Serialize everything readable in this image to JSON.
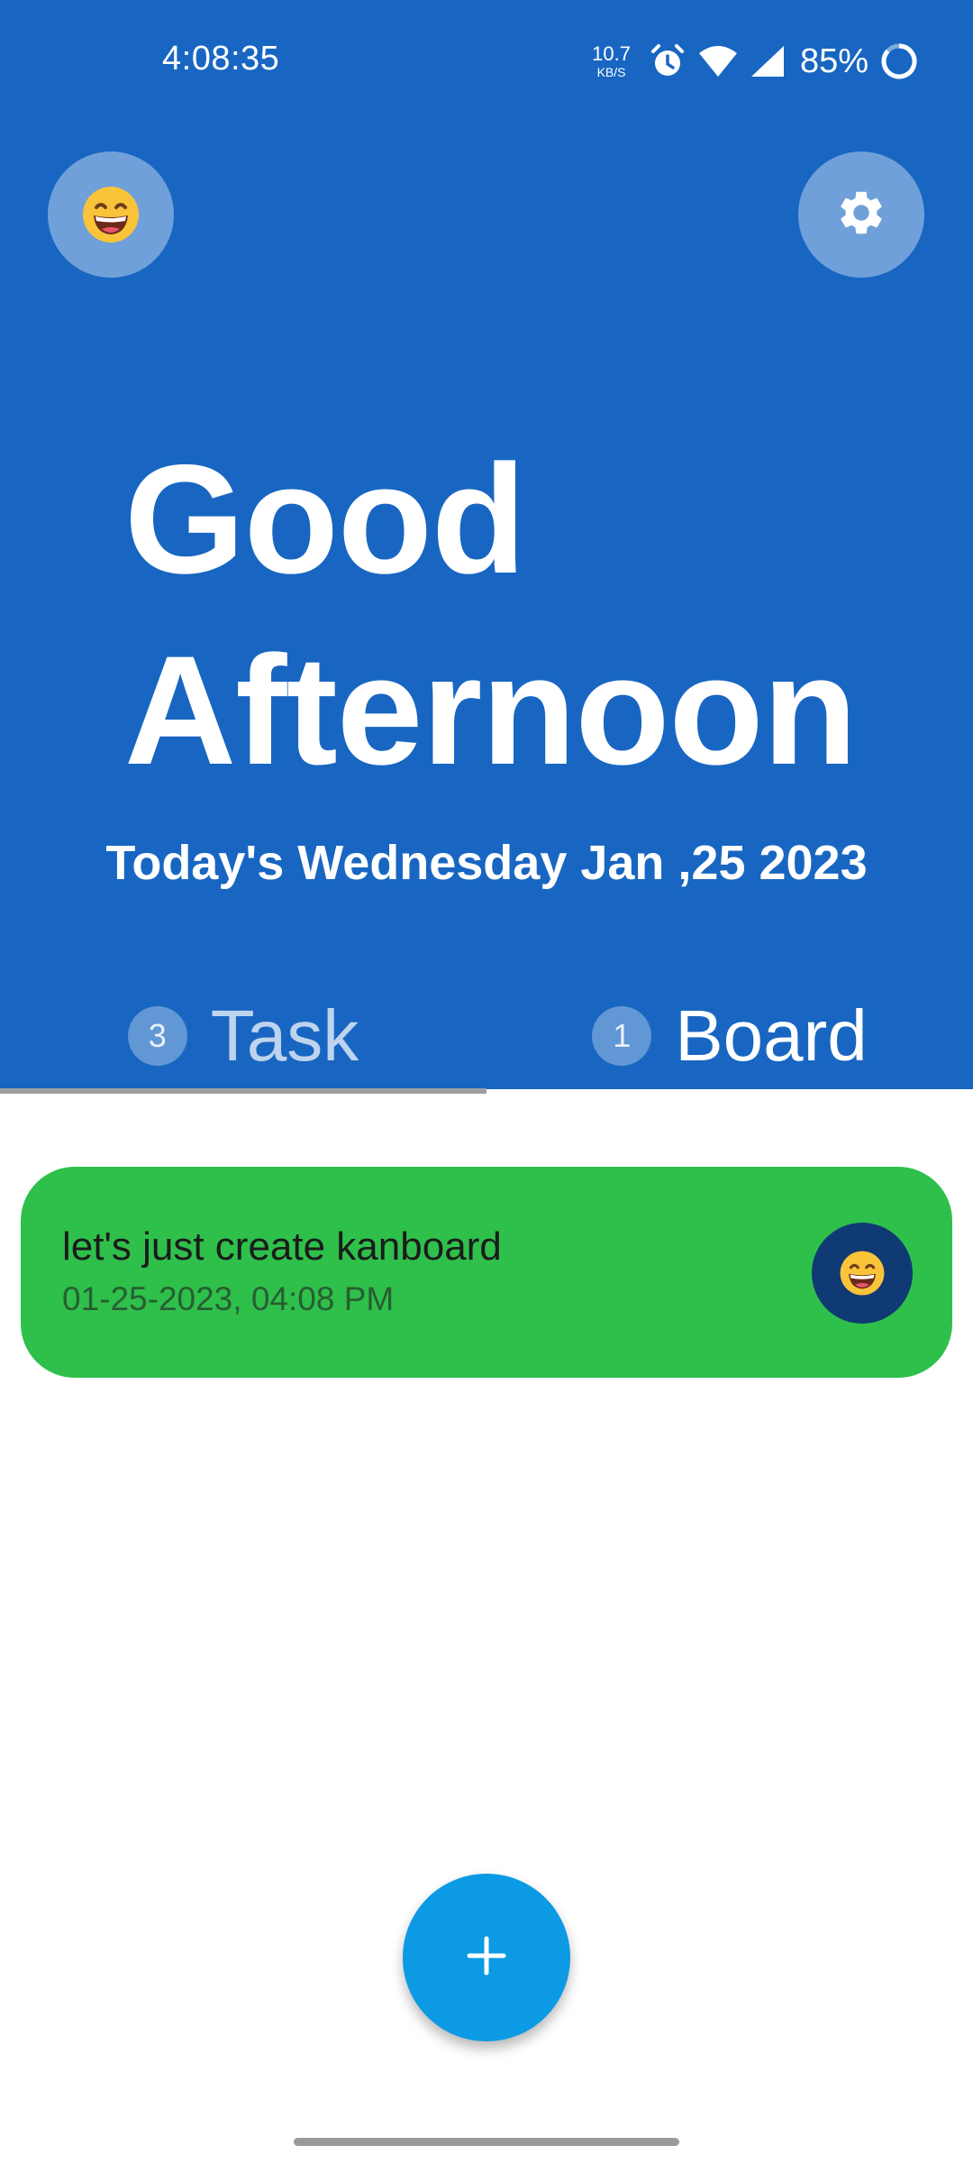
{
  "status_bar": {
    "time": "4:08:35",
    "net_speed_value": "10.7",
    "net_speed_unit": "KB/S",
    "battery_percent": "85%",
    "icons": [
      "alarm-icon",
      "wifi-icon",
      "signal-icon",
      "battery-ring-icon"
    ]
  },
  "header": {
    "avatar_icon": "smiling-face-emoji",
    "settings_icon": "gear-icon",
    "greeting_line1": "Good",
    "greeting_line2": "Afternoon",
    "date_text": "Today's Wednesday Jan ,25 2023",
    "background_color": "#1866c2"
  },
  "tabs": [
    {
      "label": "Task",
      "count": "3",
      "selected": true
    },
    {
      "label": "Board",
      "count": "1",
      "selected": false
    }
  ],
  "tasks": [
    {
      "title": "let's just create kanboard",
      "datetime": "01-25-2023, 04:08 PM",
      "color": "#2ec04b",
      "avatar_icon": "smiling-face-emoji"
    }
  ],
  "fab": {
    "icon": "plus-icon",
    "color": "#0b9ae3"
  }
}
